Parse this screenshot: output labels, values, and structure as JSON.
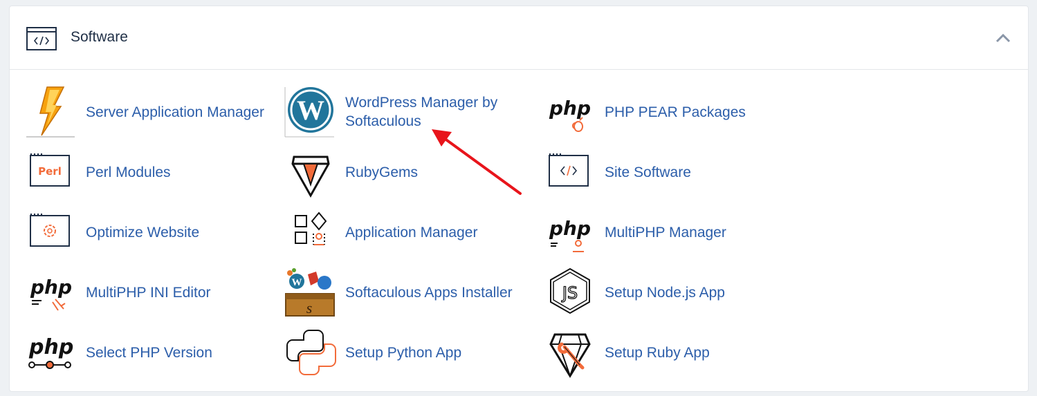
{
  "section": {
    "title": "Software"
  },
  "items": [
    {
      "label": "Server Application Manager",
      "icon": "lightning-bolt-icon"
    },
    {
      "label": "WordPress Manager by Softaculous",
      "icon": "wordpress-icon"
    },
    {
      "label": "PHP PEAR Packages",
      "icon": "php-pear-icon"
    },
    {
      "label": "Perl Modules",
      "icon": "perl-icon"
    },
    {
      "label": "RubyGems",
      "icon": "ruby-gem-icon"
    },
    {
      "label": "Site Software",
      "icon": "code-window-icon"
    },
    {
      "label": "Optimize Website",
      "icon": "gear-window-icon"
    },
    {
      "label": "Application Manager",
      "icon": "app-grid-icon"
    },
    {
      "label": "MultiPHP Manager",
      "icon": "multiphp-manager-icon"
    },
    {
      "label": "MultiPHP INI Editor",
      "icon": "php-ini-icon"
    },
    {
      "label": "Softaculous Apps Installer",
      "icon": "softaculous-toolbox-icon"
    },
    {
      "label": "Setup Node.js App",
      "icon": "nodejs-icon"
    },
    {
      "label": "Select PHP Version",
      "icon": "php-version-icon"
    },
    {
      "label": "Setup Python App",
      "icon": "python-icon"
    },
    {
      "label": "Setup Ruby App",
      "icon": "ruby-wrench-icon"
    }
  ],
  "colors": {
    "link": "#2c5eaa",
    "accent": "#f26b3a",
    "annotation_arrow": "#e8141b"
  }
}
